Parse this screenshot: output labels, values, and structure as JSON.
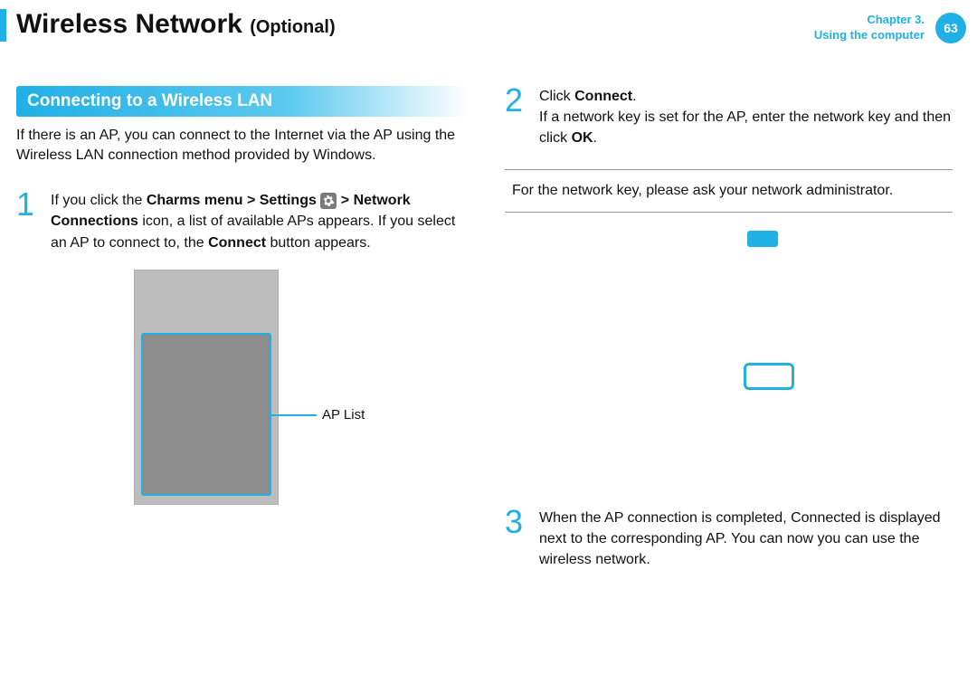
{
  "header": {
    "title_main": "Wireless Network",
    "title_optional": "(Optional)",
    "chapter_line": "Chapter 3.",
    "chapter_sub": "Using the computer",
    "page_number": "63"
  },
  "section": {
    "heading": "Connecting to a Wireless LAN",
    "intro": "If there is an AP, you can connect to the Internet via the AP using the Wireless LAN connection method provided by Windows."
  },
  "steps": {
    "s1": {
      "num": "1",
      "pre": "If you click the ",
      "bold1": "Charms menu > Settings",
      "mid1": " ",
      "bold2": " > Network Connections",
      "post": " icon, a list of available APs appears. If you select an AP to connect to, the ",
      "bold3": "Connect",
      "tail": " button appears."
    },
    "s2": {
      "num": "2",
      "line1a": "Click ",
      "line1b": "Connect",
      "line1c": ".",
      "line2a": "If a network key is set for the AP, enter the network key and then click ",
      "line2b": "OK",
      "line2c": "."
    },
    "s3": {
      "num": "3",
      "text": "When the AP connection is completed, Connected is displayed next to the corresponding AP. You can now you can use the wireless network."
    }
  },
  "figure": {
    "ap_list_label": "AP List"
  },
  "note": {
    "text": "For the network key, please ask your network administrator."
  }
}
